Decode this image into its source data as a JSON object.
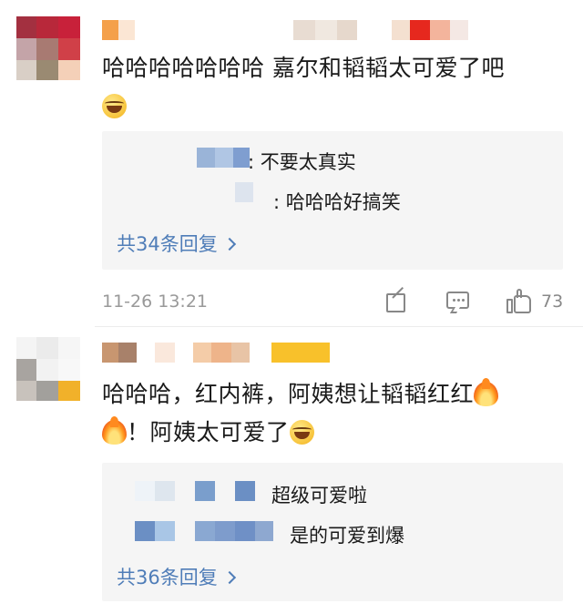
{
  "comments": [
    {
      "body_text": "哈哈哈哈哈哈哈 嘉尔和韬韬太可爱了吧",
      "body_emoji": "grinning-sweat-emoji",
      "replies": [
        {
          "text": ": 不要太真实"
        },
        {
          "text": ": 哈哈哈好搞笑"
        }
      ],
      "more_replies": "共34条回复",
      "timestamp": "11-26 13:21",
      "like_count": "73"
    },
    {
      "body_line1": "哈哈哈，红内裤，阿姨想让韬韬红红",
      "body_line2": "！阿姨太可爱了",
      "body_emojis": [
        "fire-emoji",
        "fire-emoji",
        "laughing-tears-emoji"
      ],
      "replies": [
        {
          "text": "超级可爱啦"
        },
        {
          "text": "是的可爱到爆"
        }
      ],
      "more_replies": "共36条回复"
    }
  ],
  "icons": {
    "share": "share-icon",
    "comment": "comment-icon",
    "like": "like-icon",
    "more": "chevron-right-icon"
  },
  "colors": {
    "link": "#4f7db8",
    "meta": "#999999",
    "reply_bg": "#f5f5f5",
    "text": "#1a1a1a"
  }
}
